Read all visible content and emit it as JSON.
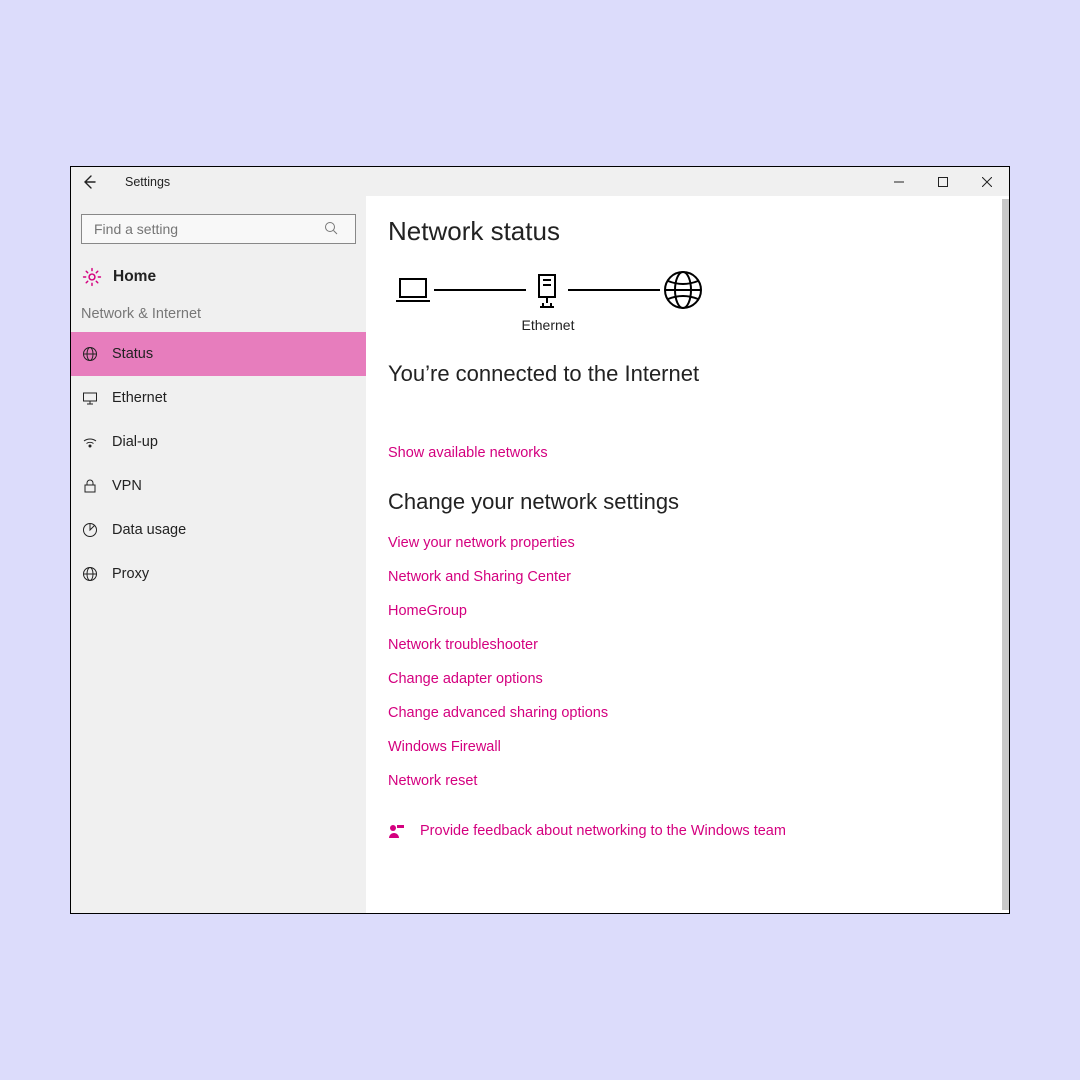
{
  "window": {
    "title": "Settings"
  },
  "search": {
    "placeholder": "Find a setting"
  },
  "home": {
    "label": "Home"
  },
  "category": "Network & Internet",
  "nav": [
    {
      "label": "Status",
      "icon": "globe-icon",
      "selected": true
    },
    {
      "label": "Ethernet",
      "icon": "monitor-icon",
      "selected": false
    },
    {
      "label": "Dial-up",
      "icon": "dialup-icon",
      "selected": false
    },
    {
      "label": "VPN",
      "icon": "vpn-icon",
      "selected": false
    },
    {
      "label": "Data usage",
      "icon": "piechart-icon",
      "selected": false
    },
    {
      "label": "Proxy",
      "icon": "globe-icon",
      "selected": false
    }
  ],
  "page": {
    "title": "Network status",
    "diagram_label": "Ethernet",
    "connection_message": "You’re connected to the Internet",
    "show_networks": "Show available networks",
    "change_heading": "Change your network settings",
    "links": [
      "View your network properties",
      "Network and Sharing Center",
      "HomeGroup",
      "Network troubleshooter",
      "Change adapter options",
      "Change advanced sharing options",
      "Windows Firewall",
      "Network reset"
    ],
    "feedback": "Provide feedback about networking to the Windows team"
  },
  "colors": {
    "accent": "#d4007f",
    "nav_selected_bg": "#e77dbd",
    "sidebar_bg": "#f0f0f0"
  }
}
